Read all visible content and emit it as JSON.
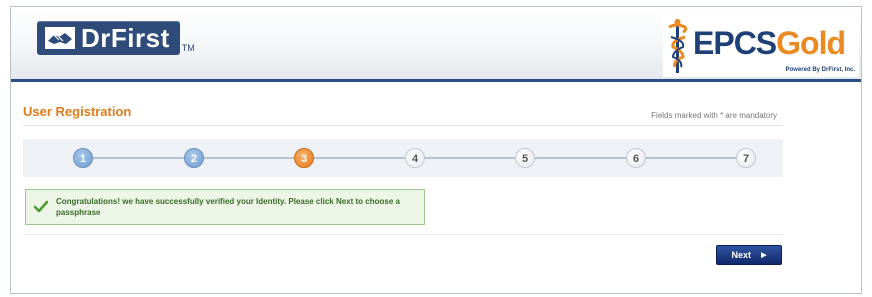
{
  "header": {
    "drfirst_logo": "DrFirst",
    "drfirst_tm": "TM",
    "epcs_logo_main": "EPCS",
    "epcs_logo_accent": "Gold",
    "epcs_powered_by": "Powered By DrFirst, Inc."
  },
  "page": {
    "title": "User Registration",
    "mandatory_note": "Fields marked with * are mandatory"
  },
  "steps": [
    {
      "label": "1",
      "state": "done"
    },
    {
      "label": "2",
      "state": "done"
    },
    {
      "label": "3",
      "state": "current"
    },
    {
      "label": "4",
      "state": "todo"
    },
    {
      "label": "5",
      "state": "todo"
    },
    {
      "label": "6",
      "state": "todo"
    },
    {
      "label": "7",
      "state": "todo"
    }
  ],
  "alert": {
    "icon": "checkmark-icon",
    "message": "Congratulations! we have successfully verified your Identity. Please click Next to choose a passphrase"
  },
  "actions": {
    "next_label": "Next",
    "next_icon": "arrow-right-icon"
  },
  "colors": {
    "brand_navy": "#2e4b79",
    "brand_orange": "#e07b1a",
    "success_green": "#3a6b2a"
  }
}
